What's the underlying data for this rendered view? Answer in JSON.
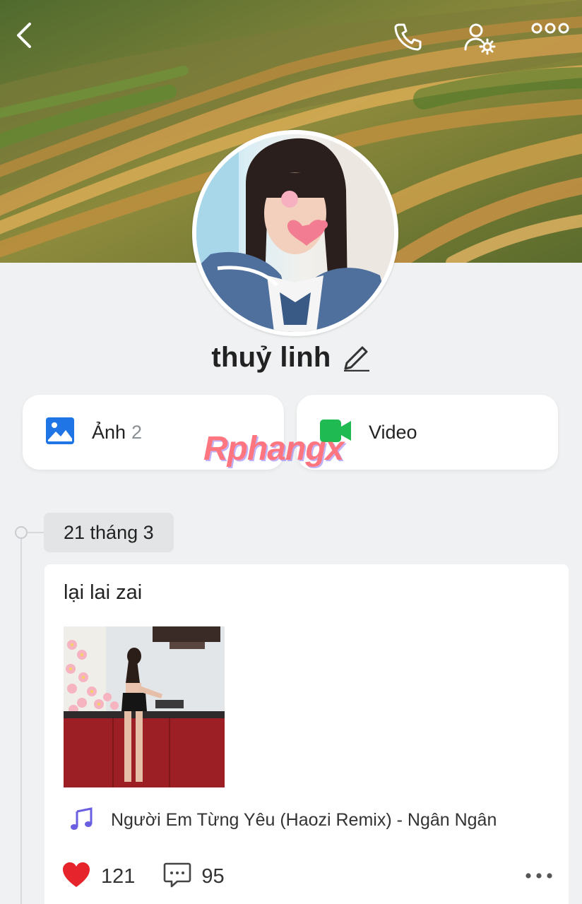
{
  "header": {
    "back_icon": "chevron-left-icon",
    "call_icon": "phone-icon",
    "settings_icon": "user-gear-icon",
    "more_icon": "more-dots-icon"
  },
  "profile": {
    "name": "thuỷ linh",
    "edit_icon": "pencil-icon"
  },
  "media": {
    "photos_label": "Ảnh",
    "photos_count": "2",
    "photos_icon": "image-icon",
    "photos_icon_color": "#1f74e6",
    "video_label": "Video",
    "video_icon": "video-camera-icon",
    "video_icon_color": "#1fbb52"
  },
  "watermark": "Rphangx",
  "timeline": {
    "date": "21 tháng 3"
  },
  "post": {
    "text": "lại lai zai",
    "music_icon": "music-note-icon",
    "music_title": "Người Em Từng Yêu (Haozi Remix) - Ngân Ngân",
    "likes": "121",
    "comments": "95",
    "like_icon": "heart-icon",
    "like_color": "#e5242b",
    "comment_icon": "comment-icon",
    "more_icon": "more-dots-icon"
  }
}
